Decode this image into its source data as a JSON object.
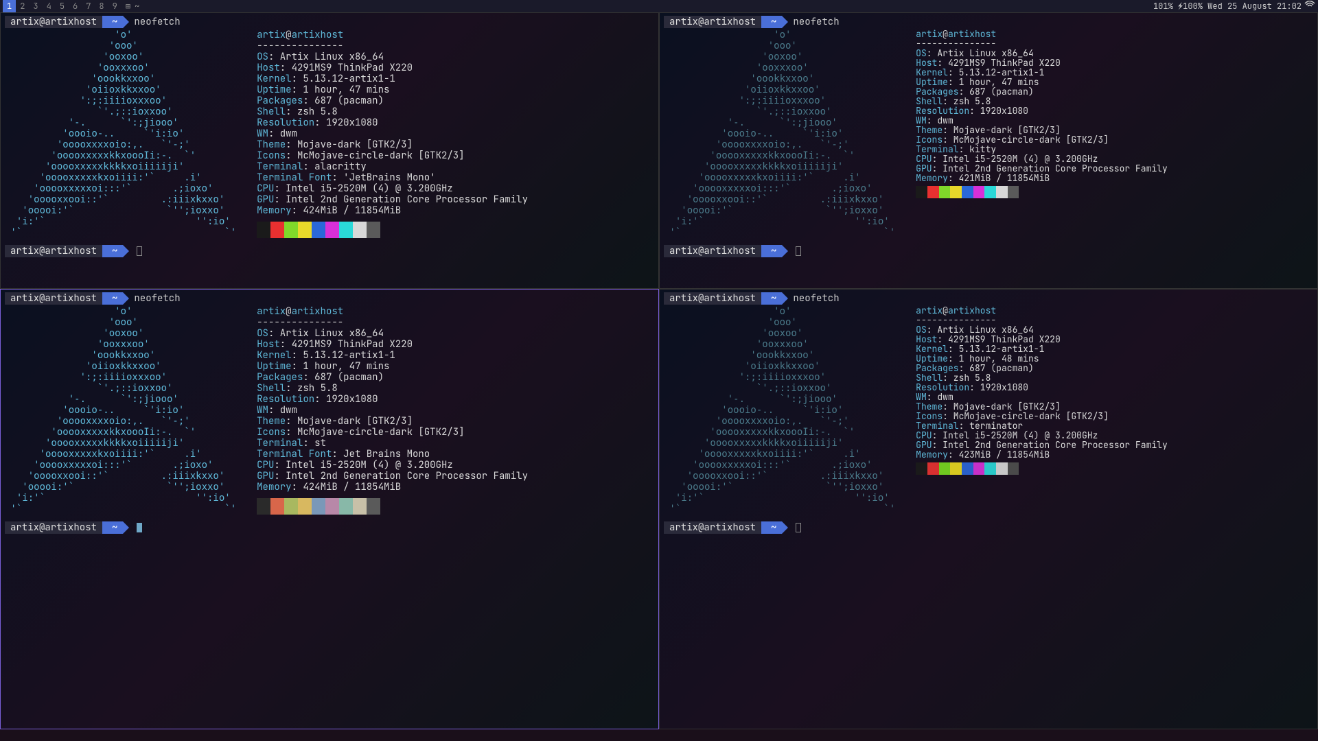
{
  "topbar": {
    "tags": [
      "1",
      "2",
      "3",
      "4",
      "5",
      "6",
      "7",
      "8",
      "9"
    ],
    "active_tag": 0,
    "status_right": "101% ⚡100%  Wed 25 August 21:02"
  },
  "prompt": {
    "user_host": "artix@artixhost",
    "path": "~",
    "cmd": "neofetch"
  },
  "ascii": "                   'o'\n                  'ooo'\n                 'ooxoo'\n                'ooxxxoo'\n               'oookkxxoo'\n              'oiioxkkxxoo'\n             ':;:iiiioxxxoo'\n                `'.;::ioxxoo'\n           '-.      `':;jiooo'\n          'oooio-..     `'i:io'\n         'ooooxxxxoio:,.   `'-;'\n        'ooooxxxxxkkxoooIi:-.  `'\n       'ooooxxxxxkkkkxoiiiiiji'\n      'ooooxxxxxkxoiiii:'`     .i'\n     'ooooxxxxxoi:::'`       .;ioxo'\n    'ooooxxooi::'`         .:iiixkxxo'\n   'ooooi:'`                `'';ioxxo'\n  'i:'`                          '':io'\n '`                                   `'",
  "header": {
    "user": "artix",
    "sep": "@",
    "host": "artixhost",
    "div": "---------------"
  },
  "terminals": [
    {
      "info": [
        {
          "k": "OS",
          "v": "Artix Linux x86_64"
        },
        {
          "k": "Host",
          "v": "4291MS9 ThinkPad X220"
        },
        {
          "k": "Kernel",
          "v": "5.13.12-artix1-1"
        },
        {
          "k": "Uptime",
          "v": "1 hour, 47 mins"
        },
        {
          "k": "Packages",
          "v": "687 (pacman)"
        },
        {
          "k": "Shell",
          "v": "zsh 5.8"
        },
        {
          "k": "Resolution",
          "v": "1920x1080"
        },
        {
          "k": "WM",
          "v": "dwm"
        },
        {
          "k": "Theme",
          "v": "Mojave-dark [GTK2/3]"
        },
        {
          "k": "Icons",
          "v": "McMojave-circle-dark [GTK2/3]"
        },
        {
          "k": "Terminal",
          "v": "alacritty"
        },
        {
          "k": "Terminal Font",
          "v": "'JetBrains Mono'"
        },
        {
          "k": "CPU",
          "v": "Intel i5-2520M (4) @ 3.200GHz"
        },
        {
          "k": "GPU",
          "v": "Intel 2nd Generation Core Processor Family"
        },
        {
          "k": "Memory",
          "v": "424MiB / 11854MiB"
        }
      ],
      "colors": [
        "#1a1a1a",
        "#e83030",
        "#80d82a",
        "#e8d82a",
        "#2a68d8",
        "#d830d8",
        "#2ad8d8",
        "#d8d8d8",
        "#5a5a5a",
        "#ff6a6a",
        "#b0ff6a",
        "#ffff6a",
        "#6aa8ff",
        "#ff6aff",
        "#6affff",
        "#ffffff"
      ]
    },
    {
      "info": [
        {
          "k": "OS",
          "v": "Artix Linux x86_64"
        },
        {
          "k": "Host",
          "v": "4291MS9 ThinkPad X220"
        },
        {
          "k": "Kernel",
          "v": "5.13.12-artix1-1"
        },
        {
          "k": "Uptime",
          "v": "1 hour, 47 mins"
        },
        {
          "k": "Packages",
          "v": "687 (pacman)"
        },
        {
          "k": "Shell",
          "v": "zsh 5.8"
        },
        {
          "k": "Resolution",
          "v": "1920x1080"
        },
        {
          "k": "WM",
          "v": "dwm"
        },
        {
          "k": "Theme",
          "v": "Mojave-dark [GTK2/3]"
        },
        {
          "k": "Icons",
          "v": "McMojave-circle-dark [GTK2/3]"
        },
        {
          "k": "Terminal",
          "v": "kitty"
        },
        {
          "k": "CPU",
          "v": "Intel i5-2520M (4) @ 3.200GHz"
        },
        {
          "k": "GPU",
          "v": "Intel 2nd Generation Core Processor Family"
        },
        {
          "k": "Memory",
          "v": "421MiB / 11854MiB"
        }
      ],
      "colors": [
        "#1a1a1a",
        "#e83030",
        "#80d82a",
        "#e8d82a",
        "#2a68d8",
        "#d830d8",
        "#2ad8d8",
        "#d8d8d8",
        "#5a5a5a",
        "#ff6a6a",
        "#b0ff6a",
        "#ffff6a",
        "#6aa8ff",
        "#ff6aff",
        "#6affff",
        "#ffffff"
      ]
    },
    {
      "info": [
        {
          "k": "OS",
          "v": "Artix Linux x86_64"
        },
        {
          "k": "Host",
          "v": "4291MS9 ThinkPad X220"
        },
        {
          "k": "Kernel",
          "v": "5.13.12-artix1-1"
        },
        {
          "k": "Uptime",
          "v": "1 hour, 47 mins"
        },
        {
          "k": "Packages",
          "v": "687 (pacman)"
        },
        {
          "k": "Shell",
          "v": "zsh 5.8"
        },
        {
          "k": "Resolution",
          "v": "1920x1080"
        },
        {
          "k": "WM",
          "v": "dwm"
        },
        {
          "k": "Theme",
          "v": "Mojave-dark [GTK2/3]"
        },
        {
          "k": "Icons",
          "v": "McMojave-circle-dark [GTK2/3]"
        },
        {
          "k": "Terminal",
          "v": "st"
        },
        {
          "k": "Terminal Font",
          "v": "Jet Brains Mono"
        },
        {
          "k": "CPU",
          "v": "Intel i5-2520M (4) @ 3.200GHz"
        },
        {
          "k": "GPU",
          "v": "Intel 2nd Generation Core Processor Family"
        },
        {
          "k": "Memory",
          "v": "424MiB / 11854MiB"
        }
      ],
      "colors": [
        "#2a2a2a",
        "#d8664a",
        "#a8b860",
        "#d8b860",
        "#7a98b8",
        "#b888a8",
        "#88b8a8",
        "#c8c0a8",
        "#5a5a5a",
        "#e88868",
        "#c0d080",
        "#e8d080",
        "#98b0d0",
        "#d0a0c0",
        "#a0d0c0",
        "#e0d8c8"
      ]
    },
    {
      "info": [
        {
          "k": "OS",
          "v": "Artix Linux x86_64"
        },
        {
          "k": "Host",
          "v": "4291MS9 ThinkPad X220"
        },
        {
          "k": "Kernel",
          "v": "5.13.12-artix1-1"
        },
        {
          "k": "Uptime",
          "v": "1 hour, 48 mins"
        },
        {
          "k": "Packages",
          "v": "687 (pacman)"
        },
        {
          "k": "Shell",
          "v": "zsh 5.8"
        },
        {
          "k": "Resolution",
          "v": "1920x1080"
        },
        {
          "k": "WM",
          "v": "dwm"
        },
        {
          "k": "Theme",
          "v": "Mojave-dark [GTK2/3]"
        },
        {
          "k": "Icons",
          "v": "McMojave-circle-dark [GTK2/3]"
        },
        {
          "k": "Terminal",
          "v": "terminator"
        },
        {
          "k": "CPU",
          "v": "Intel i5-2520M (4) @ 3.200GHz"
        },
        {
          "k": "GPU",
          "v": "Intel 2nd Generation Core Processor Family"
        },
        {
          "k": "Memory",
          "v": "423MiB / 11854MiB"
        }
      ],
      "colors": [
        "#1a1a1a",
        "#d83030",
        "#70c820",
        "#d8c820",
        "#2a60c8",
        "#c830c8",
        "#2ac8c8",
        "#c8c8c8",
        "#4a4a4a",
        "#e86060",
        "#a0e860",
        "#e8e860",
        "#6098e8",
        "#e860e8",
        "#60e8e8",
        "#e8e8e8"
      ]
    }
  ]
}
